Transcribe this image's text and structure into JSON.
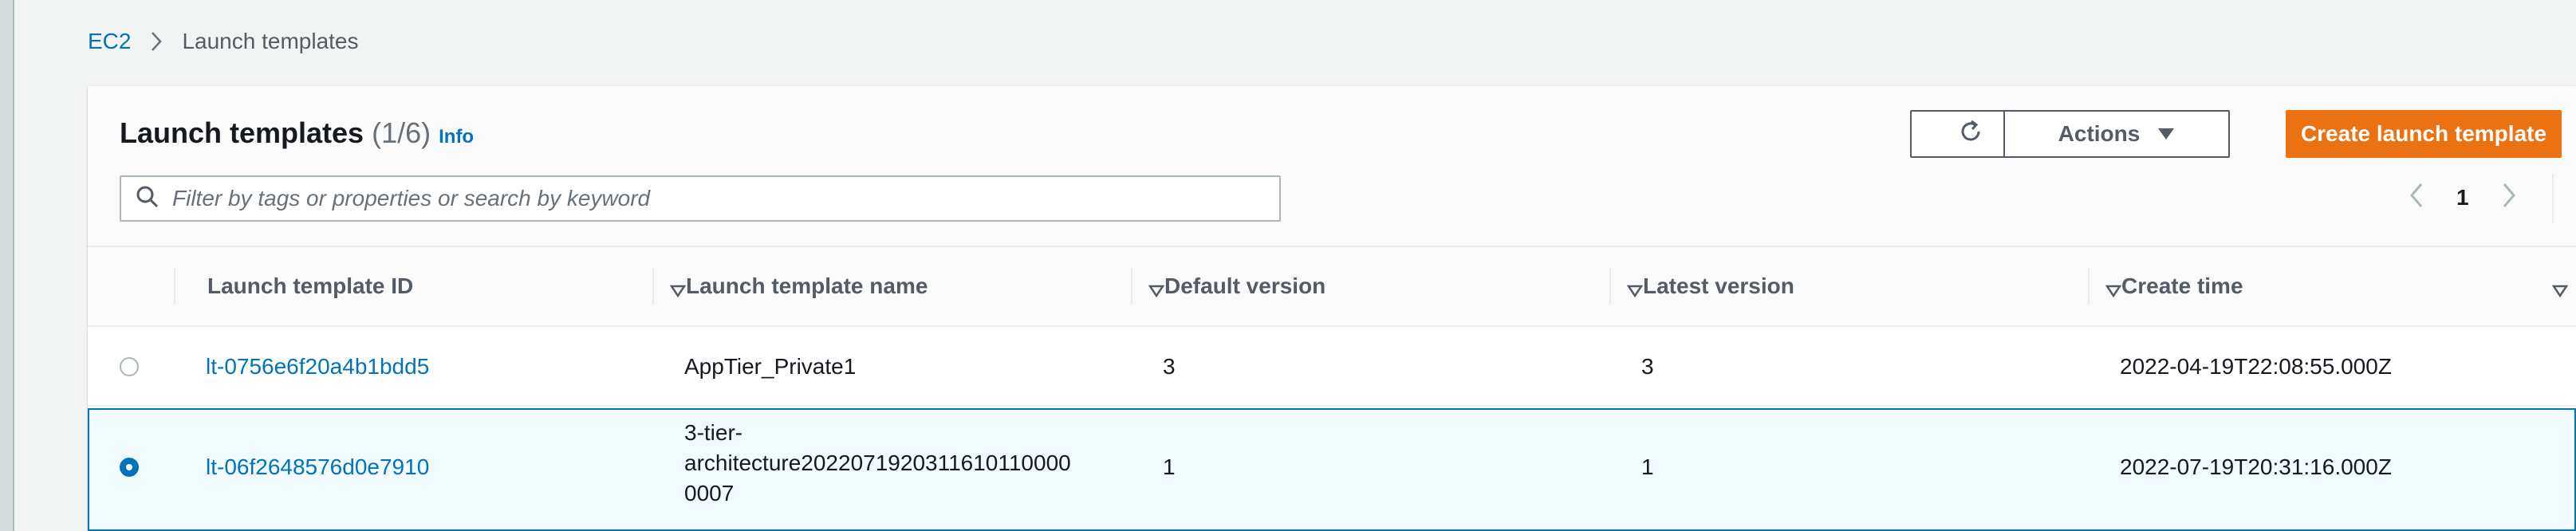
{
  "breadcrumb": {
    "root": "EC2",
    "current": "Launch templates"
  },
  "panel": {
    "title": "Launch templates",
    "count": "(1/6)",
    "info": "Info",
    "refresh_icon": "refresh-icon",
    "actions_label": "Actions",
    "create_label": "Create launch template"
  },
  "search": {
    "placeholder": "Filter by tags or properties or search by keyword"
  },
  "pagination": {
    "current_page": "1"
  },
  "table": {
    "columns": [
      "Launch template ID",
      "Launch template name",
      "Default version",
      "Latest version",
      "Create time"
    ],
    "rows": [
      {
        "selected": false,
        "id": "lt-0756e6f20a4b1bdd5",
        "name": "AppTier_Private1",
        "default_version": "3",
        "latest_version": "3",
        "create_time": "2022-04-19T22:08:55.000Z"
      },
      {
        "selected": true,
        "id": "lt-06f2648576d0e7910",
        "name_lines": [
          "3-tier-",
          "architecture2022071920311610110000",
          "0007"
        ],
        "default_version": "1",
        "latest_version": "1",
        "create_time": "2022-07-19T20:31:16.000Z"
      }
    ]
  },
  "colors": {
    "accent": "#0073bb",
    "primary_button": "#ec7211",
    "selected_row": "#f1faff"
  }
}
